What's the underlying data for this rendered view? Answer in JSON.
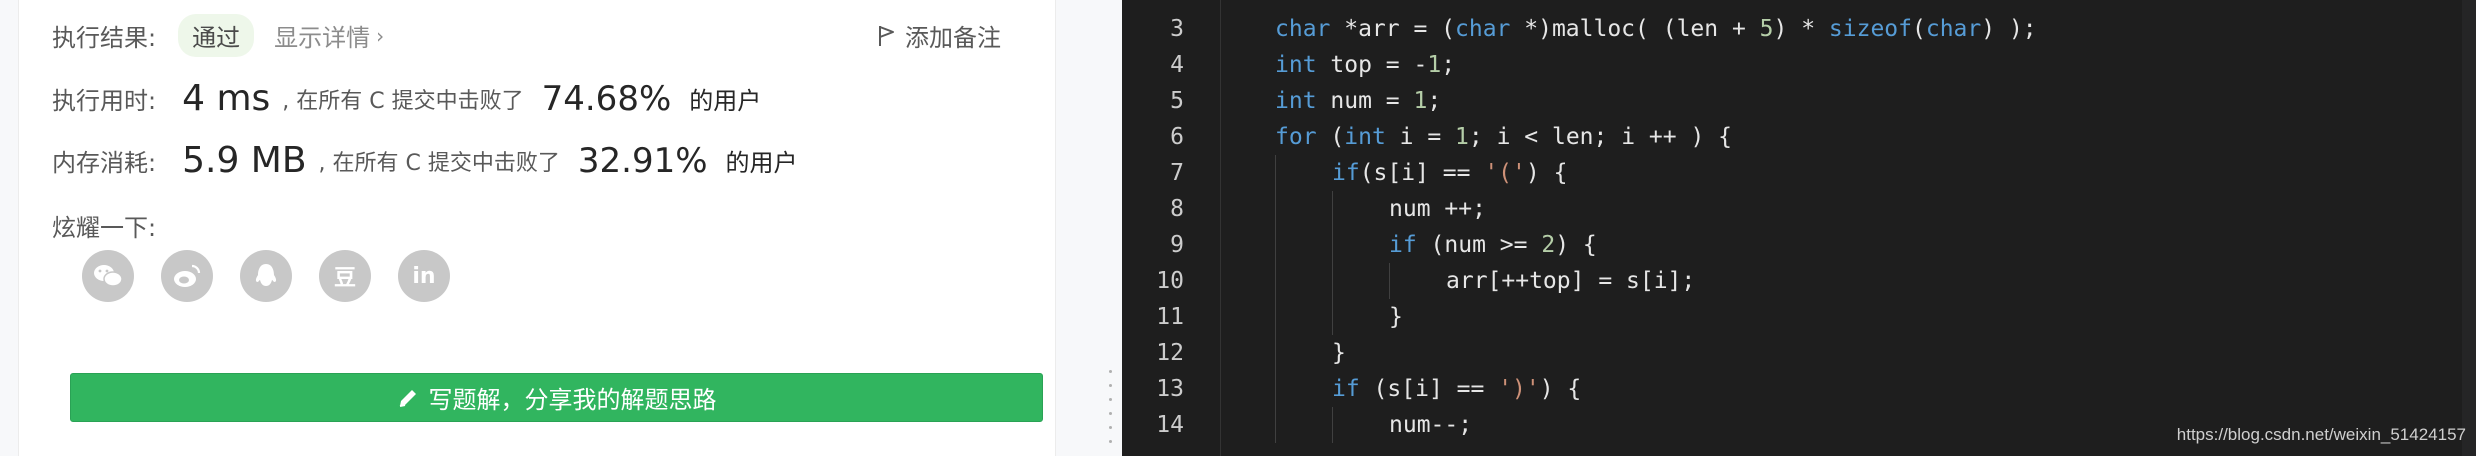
{
  "result": {
    "status_label": "执行结果:",
    "status_value": "通过",
    "detail_link": "显示详情",
    "add_note": "添加备注",
    "runtime": {
      "label": "执行用时:",
      "value": "4 ms",
      "middle": ", 在所有 C 提交中击败了",
      "percent": "74.68%",
      "tail": "的用户"
    },
    "memory": {
      "label": "内存消耗:",
      "value": "5.9 MB",
      "middle": ", 在所有 C 提交中击败了",
      "percent": "32.91%",
      "tail": "的用户"
    },
    "share_label": "炫耀一下:",
    "share_icons": [
      "wechat-icon",
      "weibo-icon",
      "qq-icon",
      "douban-icon",
      "linkedin-icon"
    ],
    "douban_glyph": "豆",
    "linkedin_glyph": "in",
    "write_button": "写题解，分享我的解题思路"
  },
  "editor": {
    "lines": [
      {
        "n": "3",
        "code": "char *arr = (char *)malloc( (len + 5) * sizeof(char) );"
      },
      {
        "n": "4",
        "code": "int top = -1;"
      },
      {
        "n": "5",
        "code": "int num = 1;"
      },
      {
        "n": "6",
        "code": "for (int i = 1; i < len; i ++ ) {"
      },
      {
        "n": "7",
        "code": "if(s[i] == '(') {"
      },
      {
        "n": "8",
        "code": "num ++;"
      },
      {
        "n": "9",
        "code": "if (num >= 2) {"
      },
      {
        "n": "10",
        "code": "arr[++top] = s[i];"
      },
      {
        "n": "11",
        "code": "}"
      },
      {
        "n": "12",
        "code": "}"
      },
      {
        "n": "13",
        "code": "if (s[i] == ')') {"
      },
      {
        "n": "14",
        "code": "num--;"
      }
    ],
    "watermark": "https://blog.csdn.net/weixin_51424157"
  },
  "colors": {
    "accent_green": "#31b55f",
    "editor_bg": "#1e1e1e",
    "keyword": "#569cd6",
    "number": "#b5cea8",
    "string": "#ce9178"
  }
}
